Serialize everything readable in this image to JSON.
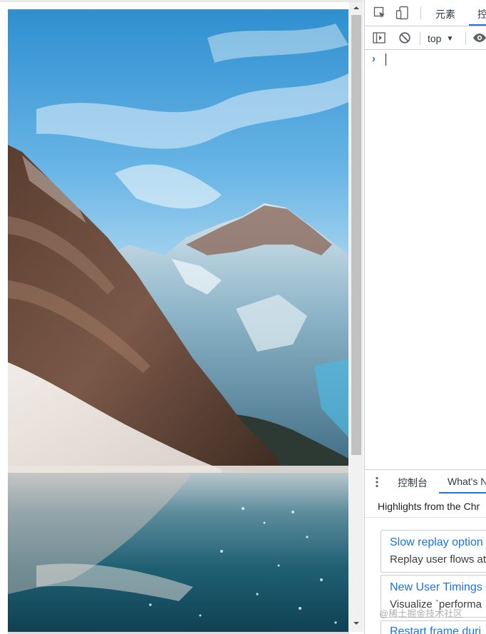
{
  "devtools": {
    "tabs": {
      "elements": "元素",
      "console_partial": "控"
    },
    "console_toolbar": {
      "context": "top",
      "context_caret": "▼"
    },
    "console": {
      "prompt": "›"
    },
    "drawer": {
      "tabs": {
        "console": "控制台",
        "whats_new": "What's N"
      },
      "highlights": "Highlights from the Chr",
      "cards": [
        {
          "title": "Slow replay option",
          "desc": "Replay user flows at"
        },
        {
          "title": "New User Timings",
          "desc": "Visualize `performa"
        },
        {
          "title": "Restart frame duri",
          "desc": ""
        }
      ]
    },
    "accent_color": "#1a73e8"
  },
  "watermark": "@稀土掘金技术社区"
}
